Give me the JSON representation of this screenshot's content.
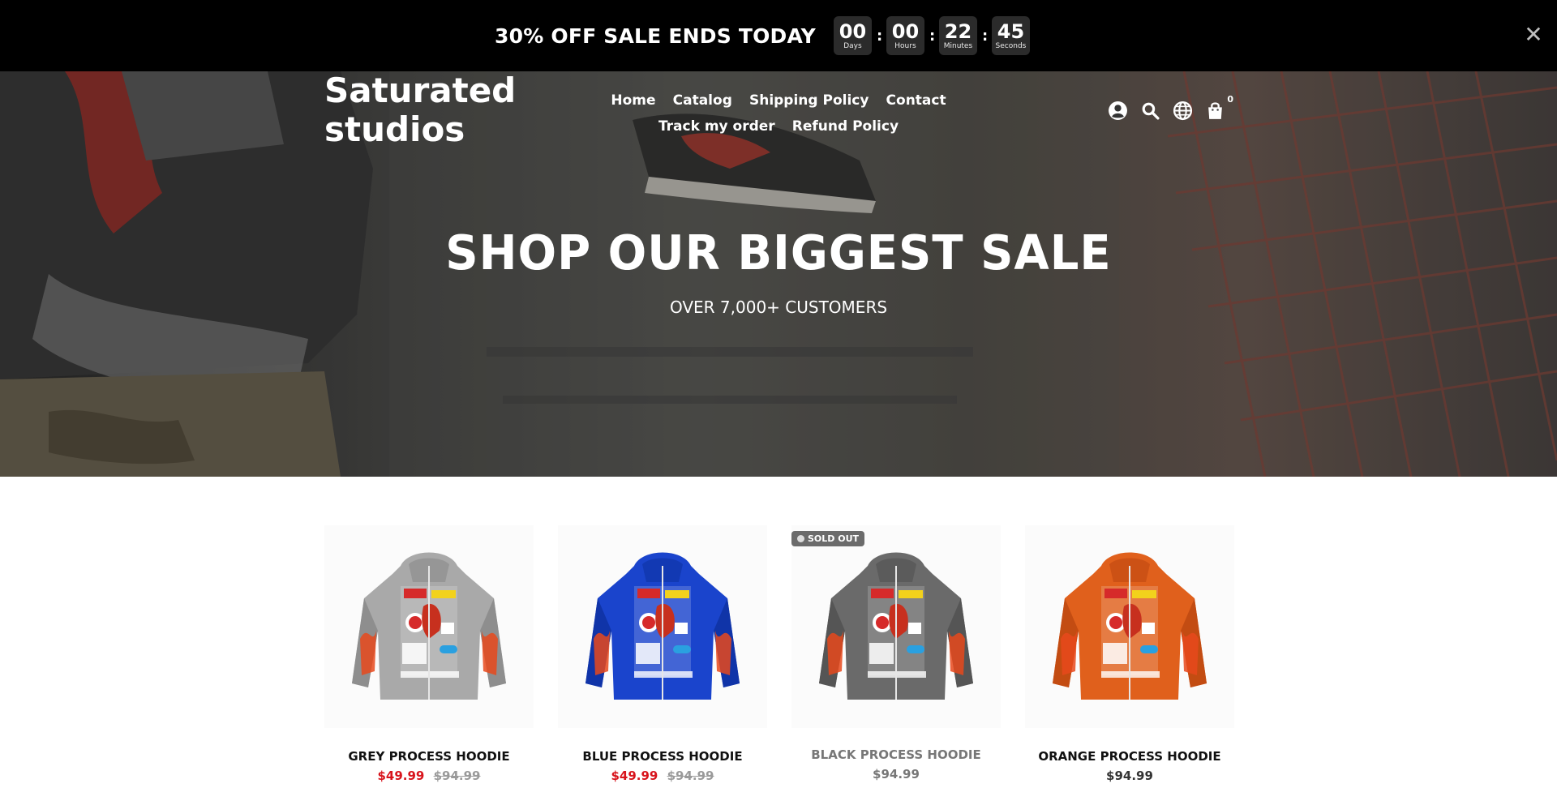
{
  "announcement": {
    "text": "30% OFF SALE ENDS TODAY",
    "countdown": [
      {
        "value": "00",
        "label": "Days"
      },
      {
        "value": "00",
        "label": "Hours"
      },
      {
        "value": "22",
        "label": "Minutes"
      },
      {
        "value": "45",
        "label": "Seconds"
      }
    ],
    "separator": ":",
    "close_icon": "close-icon",
    "close_glyph": "✕"
  },
  "header": {
    "logo": "Saturated studios",
    "nav": [
      {
        "label": "Home"
      },
      {
        "label": "Catalog"
      },
      {
        "label": "Shipping Policy"
      },
      {
        "label": "Contact"
      },
      {
        "label": "Track my order"
      },
      {
        "label": "Refund Policy"
      }
    ],
    "icons": [
      "account-icon",
      "search-icon",
      "globe-icon",
      "cart-icon"
    ],
    "cart_count": "0"
  },
  "hero": {
    "title": "SHOP OUR BIGGEST SALE",
    "subtitle": "OVER 7,000+ CUSTOMERS"
  },
  "products": [
    {
      "title": "GREY PROCESS HOODIE",
      "sale_price": "$49.99",
      "compare_price": "$94.99",
      "color": "#a9a9a9",
      "sleeve": "#8e8e8e",
      "sold_out": false
    },
    {
      "title": "BLUE PROCESS HOODIE",
      "sale_price": "$49.99",
      "compare_price": "$94.99",
      "color": "#1a44cc",
      "sleeve": "#1034a8",
      "sold_out": false
    },
    {
      "title": "BLACK PROCESS HOODIE",
      "price": "$94.99",
      "color": "#6a6a6a",
      "sleeve": "#555555",
      "sold_out": true,
      "badge": "SOLD OUT"
    },
    {
      "title": "ORANGE PROCESS HOODIE",
      "price": "$94.99",
      "color": "#e0601c",
      "sleeve": "#c34c12",
      "sold_out": false
    }
  ],
  "colors": {
    "sale_red": "#d8141c",
    "announcement_bg": "#000000"
  }
}
